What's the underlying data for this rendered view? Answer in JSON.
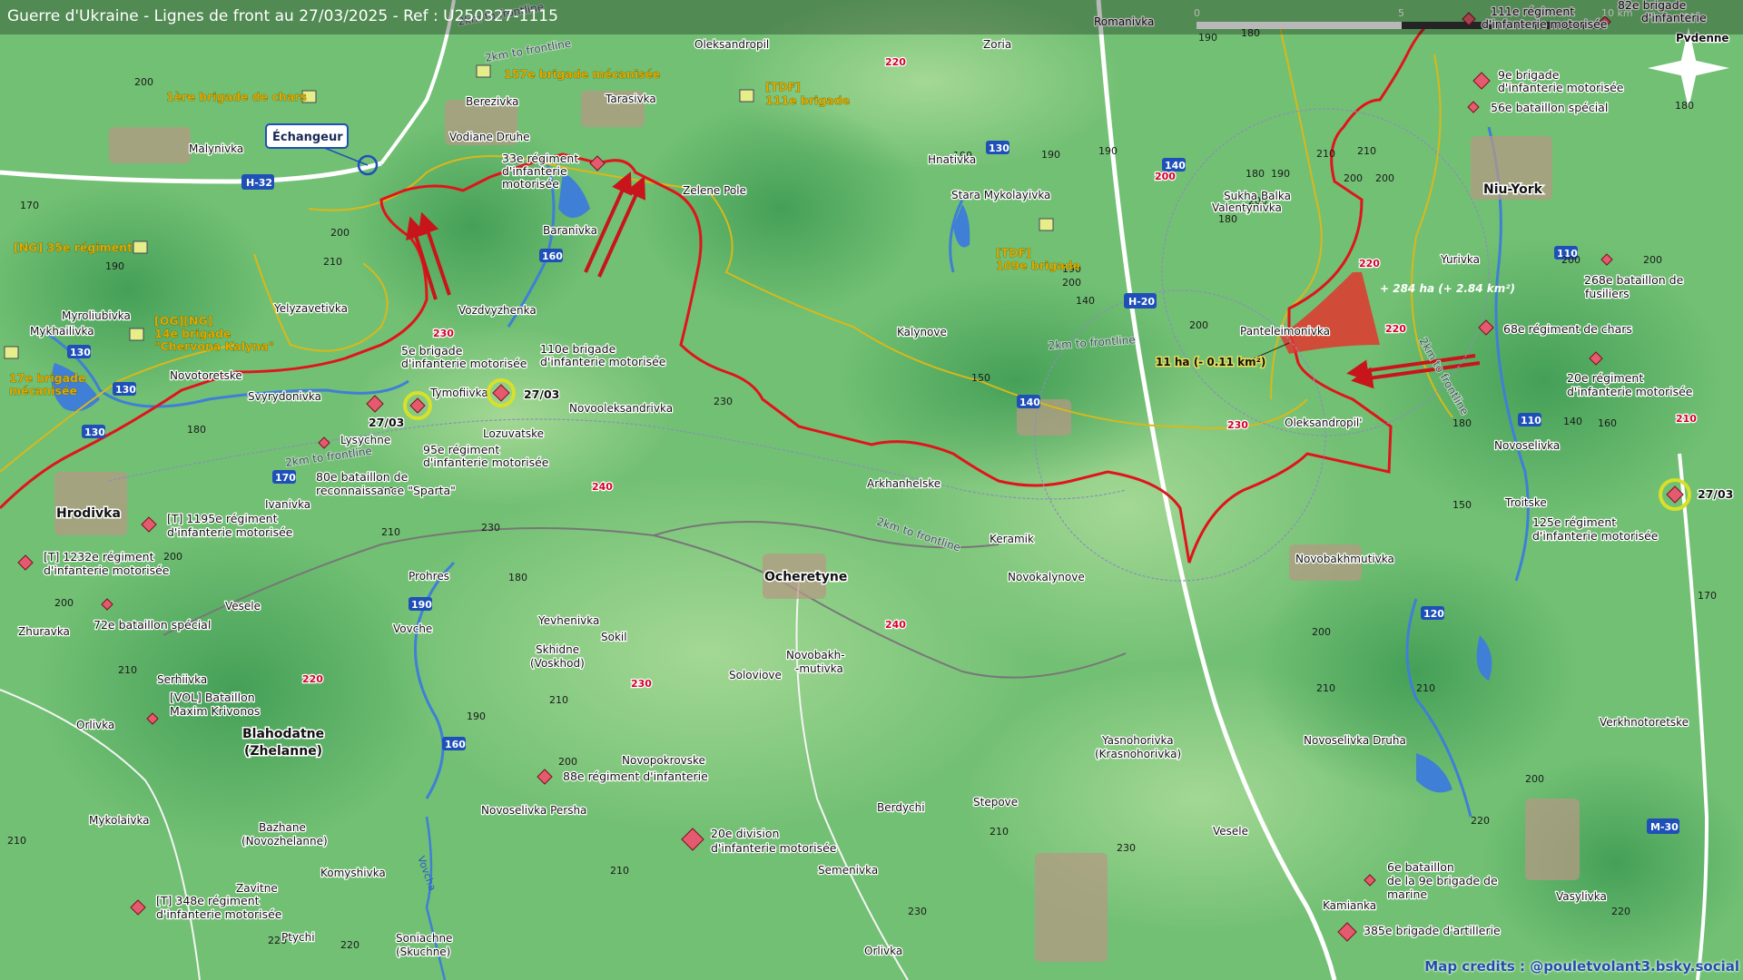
{
  "title": "Guerre d'Ukraine - Lignes de front au 27/03/2025 - Ref : U250327-1115",
  "credits": "Map credits : @pouletvolant3.bsky.social",
  "scale": {
    "labels": [
      "0",
      "5",
      "10 km"
    ],
    "north": "N"
  },
  "colors": {
    "frontline": "#e0141c",
    "ukr_line": "#d9b81a",
    "gain": "#e0372e",
    "river": "#3f7fd6",
    "terrain": "#6fbf72"
  },
  "towns": {
    "pokrovsk_area": "Pvdenne",
    "romanivka": "Romanivka",
    "oleksandropil": "Oleksandropil",
    "zoria": "Zoria",
    "malynivka": "Malynivka",
    "berezivka": "Berezivka",
    "vodiane": "Vodiane Druhe",
    "tarasivka": "Tarasivka",
    "hnativka": "Hnativka",
    "zelene": "Zelene Pole",
    "stara": "Stara Mykolayivka",
    "sukha": "Sukha Balka",
    "valentynivka": "Valentynivka",
    "baranivka": "Baranivka",
    "niu": "Niu-York",
    "yelyzavetivka": "Yelyzavetivka",
    "vozdvyzhenka": "Vozdvyzhenka",
    "myroliubivka": "Myroliubivka",
    "mykhailivka": "Mykhailivka",
    "novotoretske": "Novotoretske",
    "svyrydonivka": "Svyrydonivka",
    "tymofiivka": "Tymofiivka",
    "lysychne": "Lysychne",
    "lozuvatske": "Lozuvatske",
    "novooleksandrivka": "Novooleksandrivka",
    "kalynove": "Kalynove",
    "panteleimonivka": "Panteleimonivka",
    "oleksandropil2": "Oleksandropil'",
    "yurivka": "Yurivka",
    "novoselivka": "Novoselivka",
    "troitske": "Troitske",
    "hrodivka": "Hrodivka",
    "ivanivka": "Ivanivka",
    "arkhanhelske": "Arkhanhelske",
    "keramik": "Keramik",
    "novokalynove": "Novokalynove",
    "ocheretyne": "Ocheretyne",
    "novobakhmutivka": "Novobakhmutivka",
    "prohres": "Prohres",
    "vesele": "Vesele",
    "zhuravka": "Zhuravka",
    "vovche": "Vovche",
    "yevhenivka": "Yevhenivka",
    "sokil": "Sokil",
    "skhidne": "Skhidne",
    "voskhod": "(Voskhod)",
    "soloviove": "Soloviove",
    "novobakh1": "Novobakh-",
    "novobakh2": "-mutivka",
    "serhiivka": "Serhiivka",
    "orlivka": "Orlivka",
    "blahodatne": "Blahodatne",
    "zhelanne": "(Zhelanne)",
    "novopokrovske": "Novopokrovske",
    "novoselivka_persha": "Novoselivka Persha",
    "yasnohorivka": "Yasnohorivka",
    "krasnohorivka": "(Krasnohorivka)",
    "novoselivka_druha": "Novoselivka Druha",
    "verkhnotoretske": "Verkhnotoretske",
    "mykolaivka": "Mykolaivka",
    "bazhane": "Bazhane",
    "novozhelanne": "(Novozhelanne)",
    "berdychi": "Berdychi",
    "stepove": "Stepove",
    "vesele2": "Vesele",
    "komyshivka": "Komyshivka",
    "semenivka": "Semenivka",
    "zavitne": "Zavitne",
    "ptychi": "Ptychi",
    "soniachne": "Soniachne",
    "skuchne": "(Skuchne)",
    "orlivka2": "Orlivka",
    "kamianka": "Kamianka",
    "vasylivka": "Vasylivka",
    "river_vovcha": "Vovcha"
  },
  "roads": {
    "h32": "H-32",
    "h20": "H-20",
    "m30": "M-30",
    "r130a": "130",
    "r130b": "130",
    "r130c": "130",
    "r130d": "130",
    "r140a": "140",
    "r140b": "140",
    "r160a": "160",
    "r160b": "160",
    "r170": "170",
    "r190": "190",
    "r110a": "110",
    "r110b": "110",
    "r120": "120",
    "t220a": "220",
    "t200": "200",
    "t230a": "230",
    "t240a": "240",
    "t240b": "240",
    "t230b": "230",
    "t220b": "220",
    "t220c": "220",
    "t220d": "220",
    "t210": "210",
    "t230c": "230"
  },
  "frontline_labels": {
    "a": "2km to frontline",
    "b": "2km to frontline",
    "c": "2km to frontline",
    "d": "2km to frontline",
    "e": "2km to frontline",
    "f": "2km to frontline"
  },
  "callouts": {
    "echangeur": "Échangeur",
    "gain_big": "+ 284 ha (+ 2.84 km²)",
    "gain_small": "11 ha (- 0.11 km²)",
    "date1": "27/03",
    "date2": "27/03",
    "date3": "27/03"
  },
  "ukr_units": {
    "u1": "157e brigade mécanisée",
    "u2a": "[TDF]",
    "u2b": "111e brigade",
    "u3": "1ère brigade de chars",
    "u4": "[NG] 35e régiment",
    "u5a": "[OG][NG]",
    "u5b": "14e brigade",
    "u5c": "\"Chervona Kalyna\"",
    "u6a": "17e brigade",
    "u6b": "mécanisée",
    "u7a": "[TDF]",
    "u7b": "109e brigade"
  },
  "rus_units": {
    "r1a": "111e régiment",
    "r1b": "d'infanterie motorisée",
    "r2a": "82e brigade",
    "r2b": "d'infanterie",
    "r3a": "9e brigade",
    "r3b": "d'infanterie motorisée",
    "r4": "56e bataillon spécial",
    "r5a": "33e régiment",
    "r5b": "d'infanterie",
    "r5c": "motorisée",
    "r6a": "5e brigade",
    "r6b": "d'infanterie motorisée",
    "r7a": "110e brigade",
    "r7b": "d'infanterie motorisée",
    "r8a": "95e régiment",
    "r8b": "d'infanterie motorisée",
    "r9a": "80e bataillon de",
    "r9b": "reconnaissance \"Sparta\"",
    "r10a": "268e bataillon de",
    "r10b": "fusiliers",
    "r11": "68e régiment de chars",
    "r12a": "20e régiment",
    "r12b": "d'infanterie motorisée",
    "r13a": "125e régiment",
    "r13b": "d'infanterie motorisée",
    "r14a": "[T] 1195e régiment",
    "r14b": "d'infanterie motorisée",
    "r15a": "[T] 1232e régiment",
    "r15b": "d'infanterie motorisée",
    "r16": "72e bataillon spécial",
    "r17a": "[VOL] Bataillon",
    "r17b": "Maxim Krivonos",
    "r18": "88e régiment d'infanterie",
    "r19a": "20e division",
    "r19b": "d'infanterie motorisée",
    "r20a": "[T] 348e régiment",
    "r20b": "d'infanterie motorisée",
    "r21a": "6e bataillon",
    "r21b": "de la 9e brigade de",
    "r21c": "marine",
    "r22": "385e brigade d'artillerie"
  },
  "elevations": [
    "200",
    "170",
    "190",
    "210",
    "200",
    "180",
    "200",
    "170",
    "190",
    "180",
    "190",
    "200",
    "190",
    "210",
    "180",
    "200",
    "180",
    "200",
    "190",
    "200",
    "200",
    "210",
    "180",
    "230",
    "230",
    "210",
    "200",
    "210",
    "200",
    "190",
    "210",
    "210",
    "230",
    "220",
    "220",
    "200",
    "210",
    "210",
    "220",
    "200",
    "220",
    "230",
    "210",
    "180",
    "200",
    "200",
    "180",
    "170",
    "140",
    "160",
    "150",
    "140",
    "210",
    "200",
    "190",
    "150",
    "190",
    "180"
  ]
}
